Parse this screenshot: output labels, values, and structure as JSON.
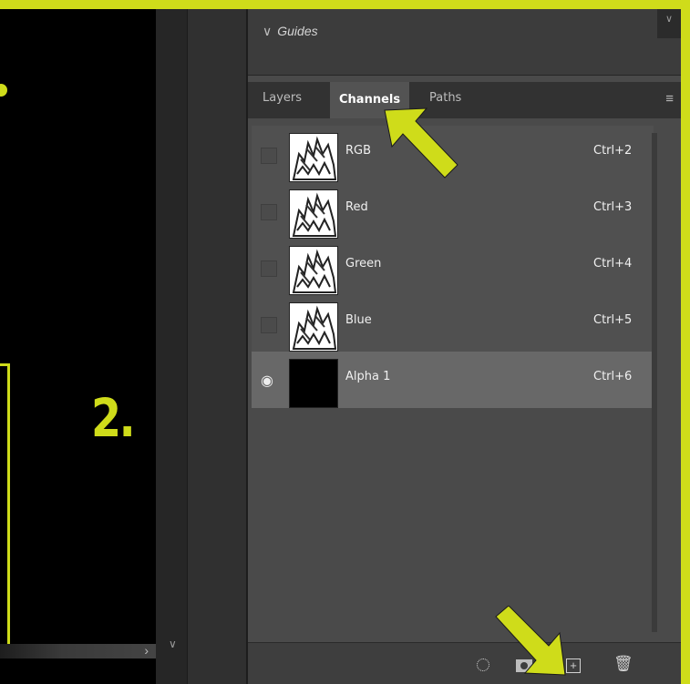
{
  "annotation": {
    "step_label": "2.",
    "accent_color": "#cfdc1a"
  },
  "guides_panel": {
    "title": "Guides",
    "collapse_icon": "chevron-down-icon"
  },
  "tabs": [
    {
      "label": "Layers",
      "active": false
    },
    {
      "label": "Channels",
      "active": true
    },
    {
      "label": "Paths",
      "active": false
    }
  ],
  "panel_menu_icon": "menu-icon",
  "channels": [
    {
      "name": "RGB",
      "shortcut": "Ctrl+2",
      "visible": false,
      "thumbnail": "image"
    },
    {
      "name": "Red",
      "shortcut": "Ctrl+3",
      "visible": false,
      "thumbnail": "image"
    },
    {
      "name": "Green",
      "shortcut": "Ctrl+4",
      "visible": false,
      "thumbnail": "image"
    },
    {
      "name": "Blue",
      "shortcut": "Ctrl+5",
      "visible": false,
      "thumbnail": "image"
    },
    {
      "name": "Alpha 1",
      "shortcut": "Ctrl+6",
      "visible": true,
      "thumbnail": "black"
    }
  ],
  "footer_icons": [
    "load-selection-icon",
    "save-selection-icon",
    "new-channel-icon",
    "delete-channel-icon"
  ]
}
